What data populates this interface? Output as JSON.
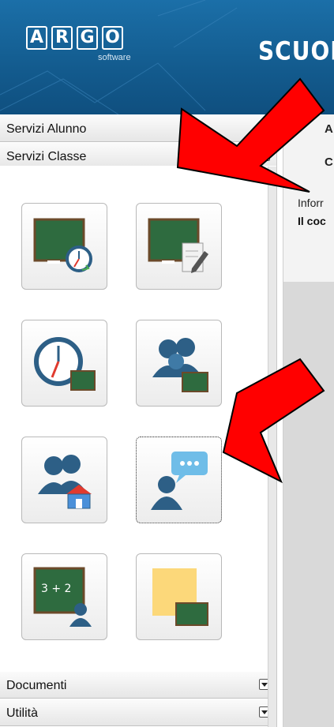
{
  "header": {
    "logo_letters": [
      "A",
      "R",
      "G",
      "O"
    ],
    "logo_sub": "software",
    "title_partial": "SCUOL"
  },
  "sidebar": {
    "sections": [
      {
        "label": "Servizi Alunno"
      },
      {
        "label": "Servizi Classe",
        "state": "expanded"
      },
      {
        "label": "Documenti",
        "state": "collapsed"
      },
      {
        "label": "Utilità",
        "state": "collapsed"
      }
    ],
    "tiles": [
      {
        "icon": "blackboard-clock-icon"
      },
      {
        "icon": "blackboard-pencil-icon"
      },
      {
        "icon": "clock-blackboard-icon"
      },
      {
        "icon": "group-blackboard-icon"
      },
      {
        "icon": "group-school-icon"
      },
      {
        "icon": "person-chat-icon",
        "selected": true
      },
      {
        "icon": "blackboard-teacher-icon"
      },
      {
        "icon": "sticky-note-blackboard-icon"
      }
    ]
  },
  "content": {
    "line1": "A",
    "line2": "C",
    "line3": "Inforr",
    "line4": "Il coc"
  },
  "colors": {
    "header_blue": "#1b6fa8",
    "chalkboard_green": "#2e6b3f",
    "icon_blue": "#2d5f86",
    "arrow_red": "#ff0000"
  }
}
